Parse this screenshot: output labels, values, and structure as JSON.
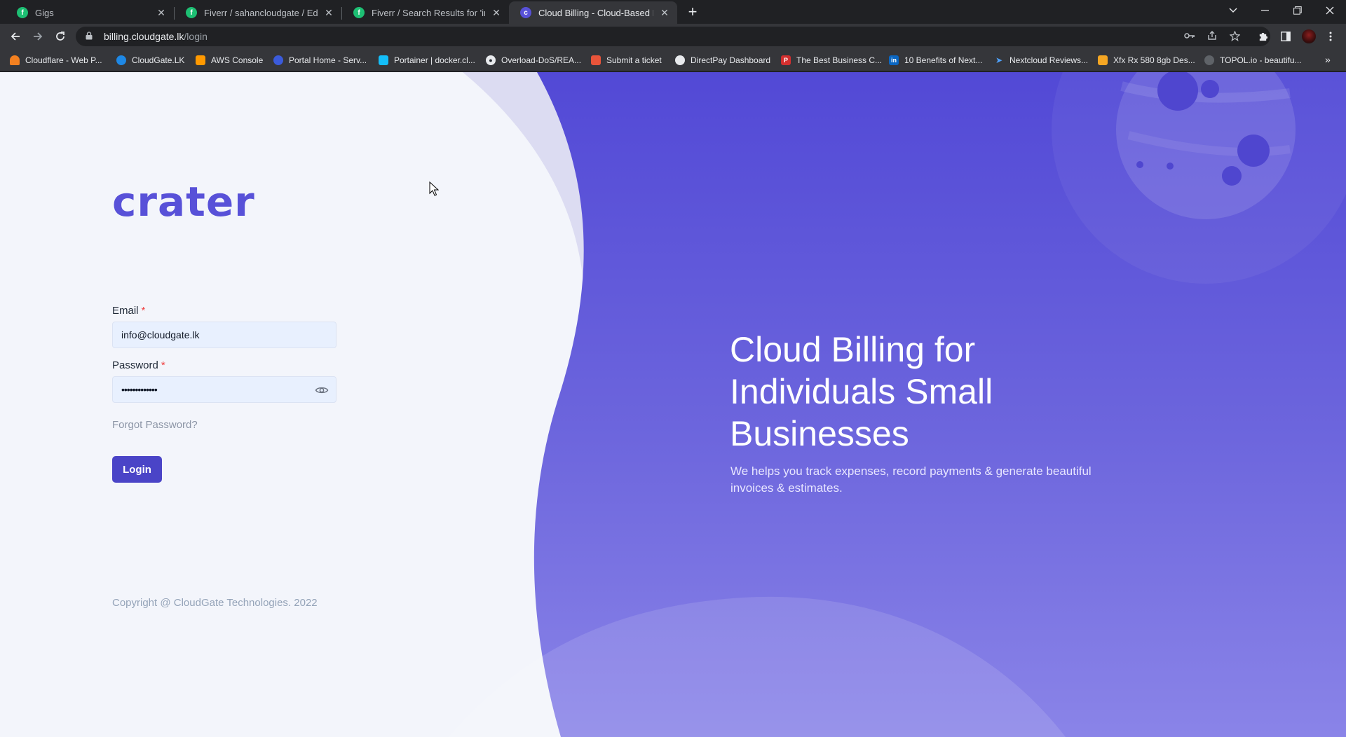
{
  "browser": {
    "tabs": [
      {
        "title": "Gigs",
        "favicon": "fiverr-icon",
        "active": false
      },
      {
        "title": "Fiverr / sahancloudgate / Edit Gig",
        "favicon": "fiverr-icon",
        "active": false
      },
      {
        "title": "Fiverr / Search Results for 'invoic",
        "favicon": "fiverr-icon",
        "active": false
      },
      {
        "title": "Cloud Billing - Cloud-Based Invoi",
        "favicon": "crater-icon",
        "active": true
      }
    ],
    "url_host": "billing.cloudgate.lk",
    "url_path": "/login",
    "bookmarks": [
      {
        "label": "Cloudflare - Web P...",
        "icon": "cloudflare-icon",
        "color": "#f38020"
      },
      {
        "label": "CloudGate.LK",
        "icon": "cloudgate-icon",
        "color": "#1e88e5"
      },
      {
        "label": "AWS Console",
        "icon": "aws-icon",
        "color": "#ff9900"
      },
      {
        "label": "Portal Home - Serv...",
        "icon": "portal-icon",
        "color": "#3b5bdb"
      },
      {
        "label": "Portainer | docker.cl...",
        "icon": "portainer-icon",
        "color": "#13bef9"
      },
      {
        "label": "Overload-DoS/REA...",
        "icon": "github-icon",
        "color": "#24292f"
      },
      {
        "label": "Submit a ticket",
        "icon": "ticket-icon",
        "color": "#e8543a"
      },
      {
        "label": "DirectPay Dashboard",
        "icon": "directpay-icon",
        "color": "#5f6368"
      },
      {
        "label": "The Best Business C...",
        "icon": "pc-icon",
        "color": "#d32f2f"
      },
      {
        "label": "10 Benefits of Next...",
        "icon": "linkedin-icon",
        "color": "#0a66c2"
      },
      {
        "label": "Nextcloud Reviews...",
        "icon": "nextcloud-icon",
        "color": "#1a73e8"
      },
      {
        "label": "Xfx Rx 580 8gb Des...",
        "icon": "aliexpress-icon",
        "color": "#f5a623"
      },
      {
        "label": "TOPOL.io - beautifu...",
        "icon": "topol-icon",
        "color": "#5f6368"
      }
    ]
  },
  "login": {
    "logo_text": "crater",
    "email_label": "Email",
    "email_value": "info@cloudgate.lk",
    "required_mark": "*",
    "password_label": "Password",
    "password_value": "•••••••••••••",
    "forgot_label": "Forgot Password?",
    "login_label": "Login",
    "copyright": "Copyright @ CloudGate Technologies. 2022"
  },
  "hero": {
    "title": "Cloud Billing for Individuals Small Businesses",
    "subtitle": "We helps you track expenses, record payments & generate beautiful invoices & estimates."
  },
  "colors": {
    "brand": "#5851d8",
    "button": "#4a44c7",
    "hero_top": "#554bd8",
    "hero_bottom": "#8a82ea"
  }
}
